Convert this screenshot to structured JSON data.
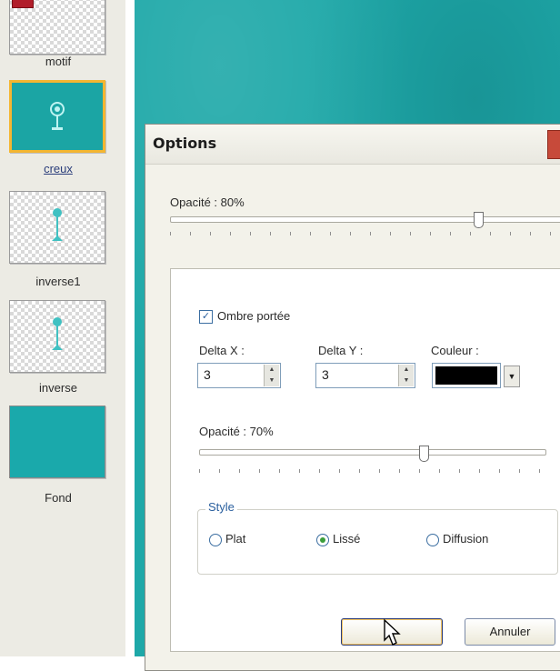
{
  "layers": [
    {
      "label": "motif"
    },
    {
      "label": "creux"
    },
    {
      "label": "inverse1"
    },
    {
      "label": "inverse"
    },
    {
      "label": "Fond"
    }
  ],
  "icons": {
    "motif": "motif-badge-icon",
    "creux": "tree-icon",
    "inverse1": "tree-icon",
    "inverse": "tree-icon",
    "cursor": "mouse-pointer-icon"
  },
  "dialog": {
    "title": "Options",
    "opacity_top": {
      "label": "Opacité : 80%",
      "value": 0.8
    },
    "shadow": {
      "label": "Ombre portée",
      "checked": true
    },
    "delta_x": {
      "label": "Delta X :",
      "value": "3"
    },
    "delta_y": {
      "label": "Delta Y :",
      "value": "3"
    },
    "color": {
      "label": "Couleur :",
      "value": "#000000"
    },
    "opacity_inner": {
      "label": "Opacité : 70%",
      "value": 0.7
    },
    "style": {
      "legend": "Style",
      "options": [
        "Plat",
        "Lissé",
        "Diffusion"
      ],
      "selected": "Lissé"
    },
    "buttons": {
      "cancel": "Annuler"
    }
  },
  "colors": {
    "teal": "#1ea8a8",
    "selection_border": "#f4b631",
    "dialog_bg": "#f3f2ea"
  }
}
